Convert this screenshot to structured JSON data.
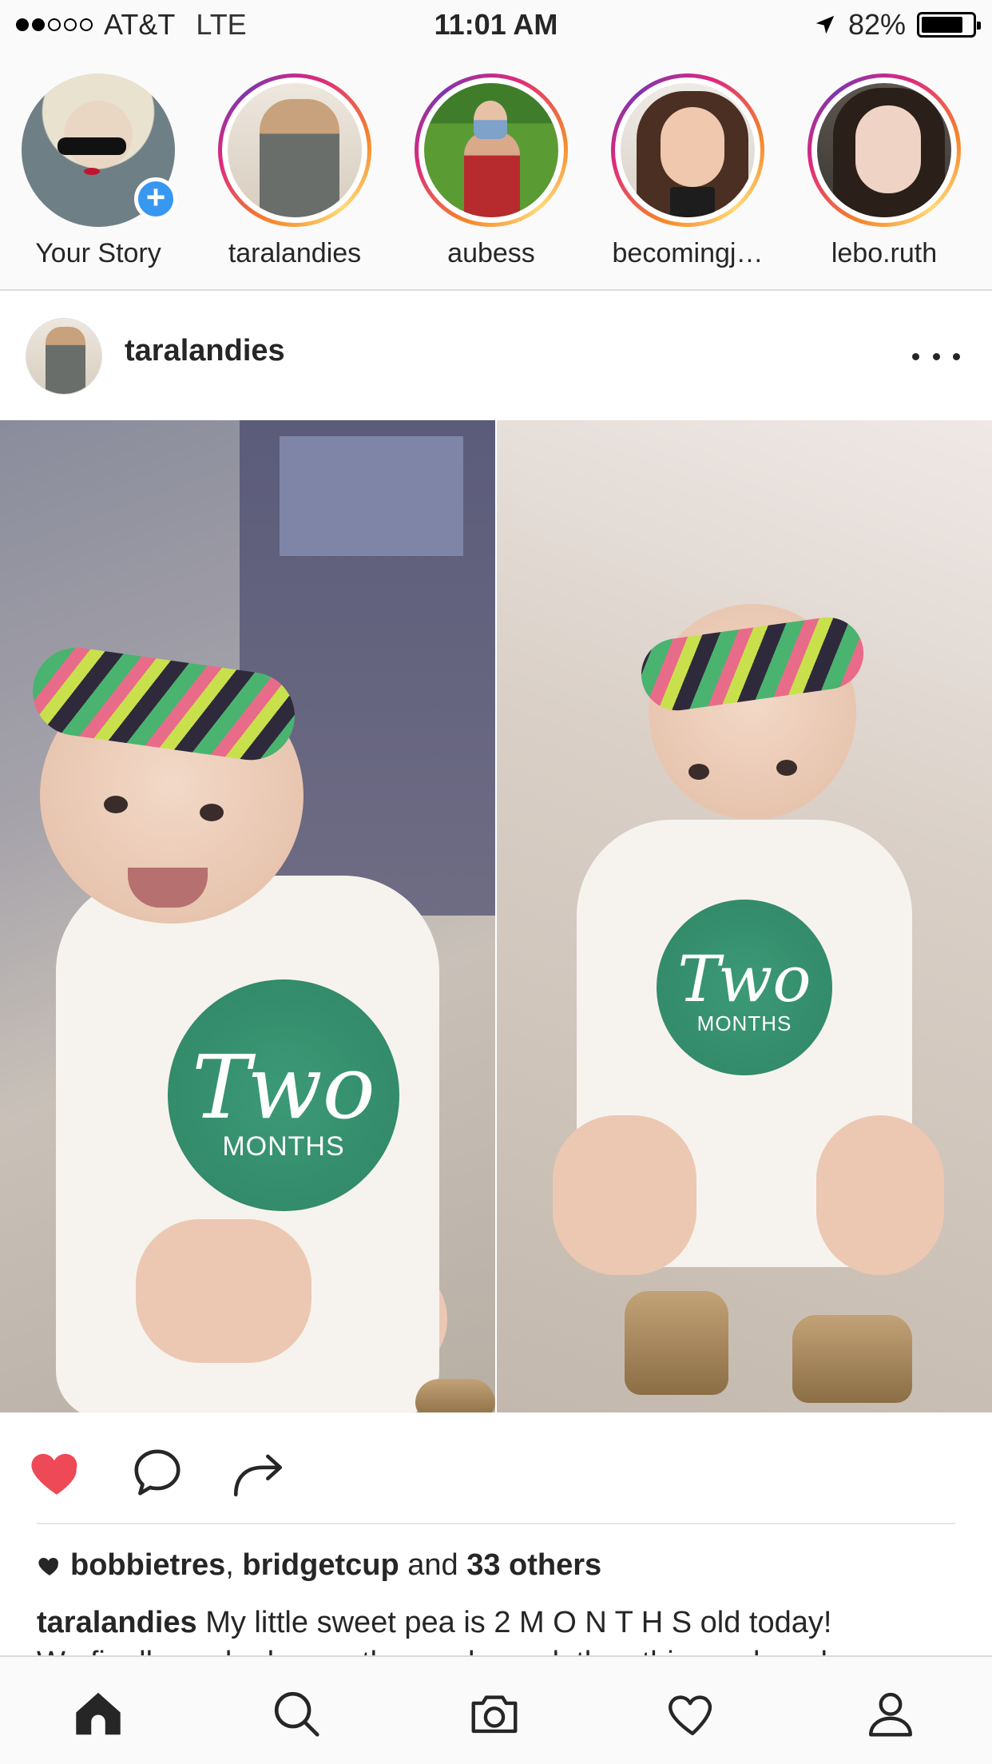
{
  "status_bar": {
    "carrier": "AT&T",
    "network": "LTE",
    "time": "11:01 AM",
    "battery": "82%",
    "signal_strength": 2,
    "icons": [
      "location-arrow-icon",
      "battery-icon"
    ]
  },
  "stories": [
    {
      "label": "Your Story",
      "badge": "+"
    },
    {
      "label": "taralandies"
    },
    {
      "label": "aubess"
    },
    {
      "label": "becomingj…"
    },
    {
      "label": "lebo.ruth"
    }
  ],
  "post": {
    "username": "taralandies",
    "image": {
      "left_sticker_big": "Two",
      "left_sticker_small": "MONTHS",
      "right_sticker_big": "Two",
      "right_sticker_small": "MONTHS"
    },
    "liked": true,
    "likes": {
      "user1": "bobbietres",
      "comma": ",",
      "user2": "bridgetcup",
      "and": "and",
      "others": "33 others"
    },
    "caption": {
      "username": "taralandies",
      "text": "My little sweet pea is 2 M O N T H S old today!",
      "second_line": "We finally packed away the newborn clothes this week and"
    }
  },
  "tabs": [
    "home-icon",
    "search-icon",
    "camera-icon",
    "heart-icon",
    "profile-icon"
  ],
  "colors": {
    "like_red": "#ed4956",
    "story_ring": "#dd2a7b",
    "add_badge": "#3897f0"
  }
}
